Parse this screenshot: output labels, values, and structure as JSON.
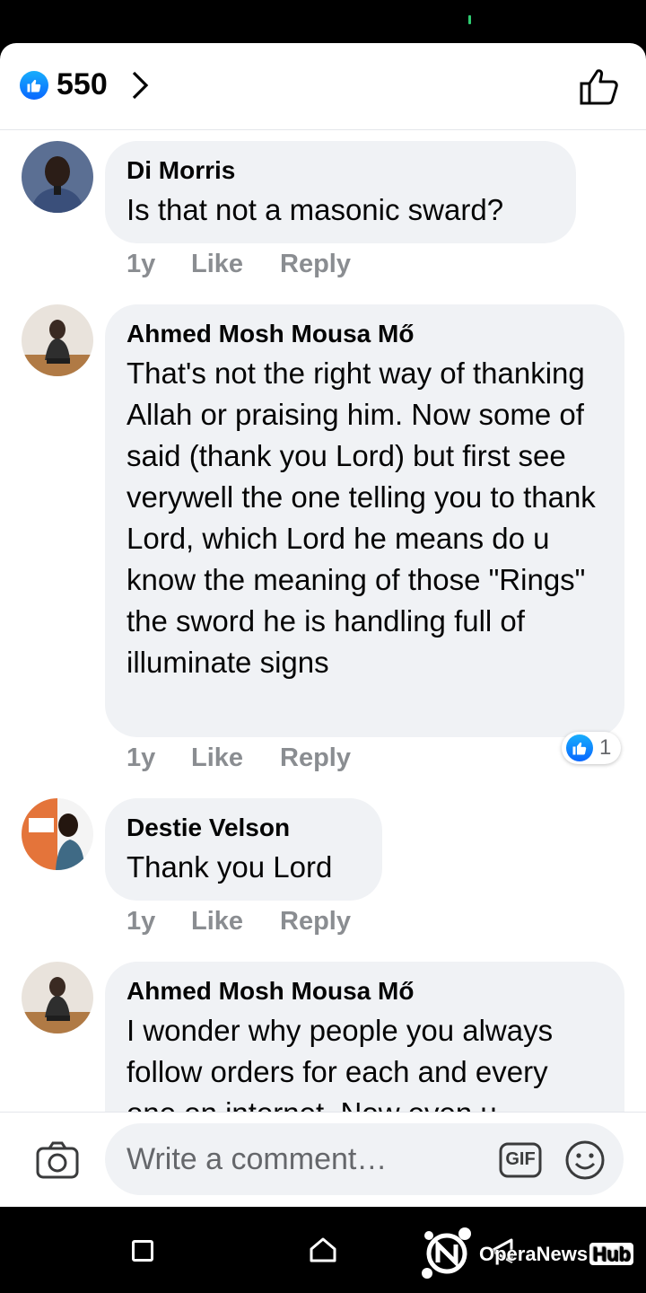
{
  "reactions": {
    "count": "550",
    "like_icon": "like-icon",
    "chevron_icon": "chevron-right-icon",
    "thumb_icon": "thumbs-up-outline-icon"
  },
  "comments": [
    {
      "author": "Di Morris",
      "text": "Is that not a masonic sward?",
      "time": "1y",
      "like_label": "Like",
      "reply_label": "Reply"
    },
    {
      "author": "Ahmed Mosh Mousa Mő",
      "text": "That's not the right way of thanking Allah or praising him. Now some of said (thank you Lord) but first see verywell the one telling you to thank Lord, which Lord he means do u know the meaning of those \"Rings\" the sword he is handling full of illuminate signs",
      "time": "1y",
      "like_label": "Like",
      "reply_label": "Reply",
      "reaction_count": "1"
    },
    {
      "author": "Destie Velson",
      "text": "Thank you Lord",
      "time": "1y",
      "like_label": "Like",
      "reply_label": "Reply"
    },
    {
      "author": "Ahmed Mosh Mousa Mő",
      "text": "I wonder why people you always follow orders for each and every one on internet. Now even u"
    }
  ],
  "composer": {
    "placeholder": "Write a comment…",
    "gif_label": "GIF"
  },
  "watermark": {
    "brand": "OperaNews",
    "hub": "Hub"
  },
  "colors": {
    "accent": "#0866ff",
    "bubble": "#f0f2f5",
    "meta": "#8a8d91"
  }
}
